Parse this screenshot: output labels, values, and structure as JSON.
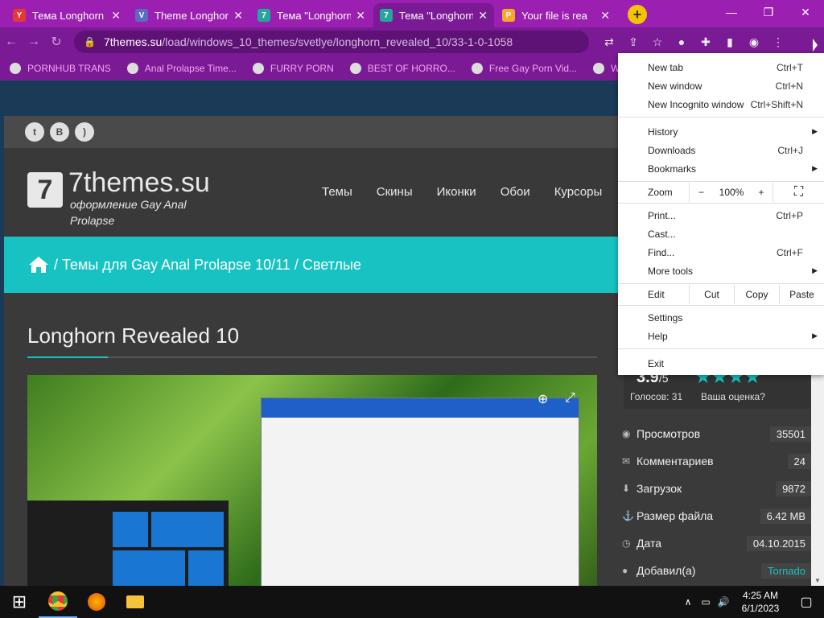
{
  "tabs": [
    {
      "title": "Тема Longhorn",
      "fav": "Y",
      "favcolor": "#e53935",
      "active": false
    },
    {
      "title": "Theme Longhorn",
      "fav": "V",
      "favcolor": "#5c6bc0",
      "active": false
    },
    {
      "title": "Тема \"Longhorn",
      "fav": "7",
      "favcolor": "#26a69a",
      "active": false
    },
    {
      "title": "Тема \"Longhorn",
      "fav": "7",
      "favcolor": "#26a69a",
      "active": true
    },
    {
      "title": "Your file is rea",
      "fav": "P",
      "favcolor": "#f9a825",
      "active": false
    }
  ],
  "newtab": "+",
  "window": {
    "min": "—",
    "max": "❐",
    "close": "✕"
  },
  "omnibox": {
    "host": "7themes.su",
    "path": "/load/windows_10_themes/svetlye/longhorn_revealed_10/33-1-0-1058"
  },
  "bookmarks": [
    {
      "label": "PORNHUB TRANS"
    },
    {
      "label": "Anal Prolapse Time..."
    },
    {
      "label": "FURRY PORN"
    },
    {
      "label": "BEST OF HORRO..."
    },
    {
      "label": "Free Gay Porn Vid..."
    },
    {
      "label": "Wa"
    }
  ],
  "site": {
    "logo": "7themes.su",
    "logo_mark": "7",
    "tagline": "оформление Gay Anal Prolapse",
    "menu": [
      "Темы",
      "Скины",
      "Иконки",
      "Обои",
      "Курсоры"
    ],
    "breadcrumb": "/ Темы для Gay Anal Prolapse 10/11 / Светлые",
    "title": "Longhorn Revealed 10"
  },
  "rating": {
    "value": "3.9",
    "max": "/5",
    "votes": "Голосов: 31",
    "stars": "★★★★",
    "yours": "Ваша оценка?"
  },
  "stats": [
    {
      "icon": "eye-icon",
      "glyph": "◉",
      "label": "Просмотров",
      "value": "35501"
    },
    {
      "icon": "comments-icon",
      "glyph": "✉",
      "label": "Комментариев",
      "value": "24"
    },
    {
      "icon": "download-icon",
      "glyph": "⬇",
      "label": "Загрузок",
      "value": "9872"
    },
    {
      "icon": "anchor-icon",
      "glyph": "⚓",
      "label": "Размер файла",
      "value": "6.42 MB"
    },
    {
      "icon": "clock-icon",
      "glyph": "◷",
      "label": "Дата",
      "value": "04.10.2015"
    },
    {
      "icon": "user-icon",
      "glyph": "●",
      "label": "Добавил(а)",
      "value": "Tornado"
    }
  ],
  "menu": {
    "new_tab": "New tab",
    "new_tab_sc": "Ctrl+T",
    "new_window": "New window",
    "new_window_sc": "Ctrl+N",
    "incognito": "New Incognito window",
    "incognito_sc": "Ctrl+Shift+N",
    "history": "History",
    "downloads": "Downloads",
    "downloads_sc": "Ctrl+J",
    "bookmarks": "Bookmarks",
    "zoom": "Zoom",
    "zoom_minus": "−",
    "zoom_value": "100%",
    "zoom_plus": "+",
    "print": "Print...",
    "print_sc": "Ctrl+P",
    "cast": "Cast...",
    "find": "Find...",
    "find_sc": "Ctrl+F",
    "more_tools": "More tools",
    "edit": "Edit",
    "cut": "Cut",
    "copy": "Copy",
    "paste": "Paste",
    "settings": "Settings",
    "help": "Help",
    "exit": "Exit"
  },
  "taskbar": {
    "time": "4:25 AM",
    "date": "6/1/2023"
  }
}
